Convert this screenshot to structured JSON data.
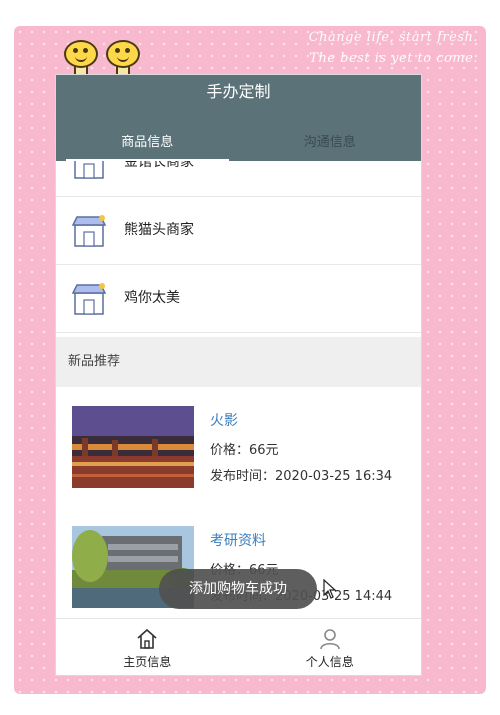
{
  "banner": {
    "line1": "Change life, start fresh.",
    "line2": "The best is yet to come."
  },
  "app": {
    "title": "手办定制"
  },
  "tabs": [
    {
      "label": "商品信息",
      "active": true
    },
    {
      "label": "沟通信息",
      "active": false
    }
  ],
  "merchants": [
    {
      "name": "金馆长商家",
      "icon": "shop-icon"
    },
    {
      "name": "熊猫头商家",
      "icon": "shop-icon"
    },
    {
      "name": "鸡你太美",
      "icon": "shop-icon"
    }
  ],
  "section": {
    "new_products": "新品推荐"
  },
  "products": [
    {
      "name": "火影",
      "price": "价格：66元",
      "time": "发布时间：2020-03-25 16:34"
    },
    {
      "name": "考研资料",
      "price": "价格：66元",
      "time": "发布时间：2020-03-25 14:44"
    }
  ],
  "toast": "添加购物车成功",
  "bottom_nav": [
    {
      "label": "主页信息",
      "icon": "home-icon"
    },
    {
      "label": "个人信息",
      "icon": "user-icon"
    }
  ],
  "colors": {
    "frame": "#f8b9cf",
    "appbar": "#5a7278",
    "product_name": "#3a7fbf"
  }
}
